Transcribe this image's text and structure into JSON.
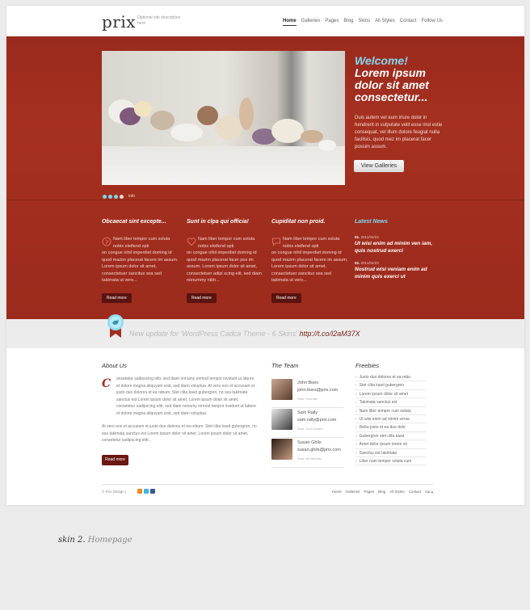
{
  "header": {
    "logo": "prix",
    "tagline": "Optional site description here",
    "nav": [
      "Home",
      "Galleries",
      "Pages",
      "Blog",
      "Skins",
      "All Styles",
      "Contact",
      "Follow Us"
    ],
    "active_nav": "Home"
  },
  "hero": {
    "welcome": "Welcome!",
    "headline": "Lorem ipsum dolor sit amet consectetur...",
    "text": "Duis autem vel eum iriure dolor in hendrerit in vulputate velit esse mol estie consequat, vel illum dolore feugiat nulla facilisis, quod mez im placerat facer possim assum.",
    "button": "View Galleries",
    "slider_info": "info"
  },
  "columns": [
    {
      "title": "Obcaecat sint excepte...",
      "icon": "circle-arrow-icon",
      "text_first": "Nam liber tempor cum soluta nobis eleifend opti",
      "text_rest": "on congue nihil imperdiet doming id quod mazim placerat facere im assum. Lorem ipsum dolor sit amet, consectetuer sancitus sea sed takimata ut vero...",
      "button": "Read more"
    },
    {
      "title": "Sunt in clpa qui officia!",
      "icon": "heart-icon",
      "text_first": "Nam liber tempor cum soluta nobis eleifend opti",
      "text_rest": "on congue nihil imperdiet doming id quod mazim placerat facer pos im assum. Lorem ipsum dolor sit amet, consectetuer adipi scing elit, sed diam nonummy nibh...",
      "button": "Read more"
    },
    {
      "title": "Cupiditat non proid.",
      "icon": "speech-bubble-icon",
      "text_first": "Nam liber tempor cum soluta nobis eleifend opti",
      "text_rest": "on congue nihil imperdiet doming id quod mazim placerat facere im assum. Lorem ipsum dolor sit amet, consectetuer sancitus sea sed takimata ut vero...",
      "button": "Read more"
    }
  ],
  "news": {
    "title": "Latest News",
    "items": [
      {
        "num": "01.",
        "date": "2011/04/24",
        "title": "Ut wisi enim ad minim ven iam, quis nostrud exerci"
      },
      {
        "num": "02.",
        "date": "2011/04/23",
        "title": "Nostrud wisi veniam enim ad minim quis exerci ut"
      }
    ]
  },
  "twitter": {
    "text": "New update for 'WordPress Cadca Theme - 6 Skins'",
    "link": "http://t.co/l2aM37X"
  },
  "about": {
    "title": "About Us",
    "para1": "onsetetur sadipscing elitr, sed diam nonumy eirmod tempor invidunt ut labore et dolore magna aliquyam erat, sed diam voluptua. At vero eos et accusam et justo duo dolores et ea rebum. Stet clita kasd gubergren, no sea takimata sanctus est Lorem ipsum dolor sit amet. Lorem ipsum dolor sit amet, consetetur sadipscing elitr, sed diam nonumy eirmod tempor invidunt ut labore et dolore magna aliquyam erat, sed diam voluptua.",
    "para2": "At vero eos et accusam et justo duo dolores et ea rebum. Stet clita kasd gubergren, no sea takimata sanctus est Lorem ipsum dolor sit amet. Lorem ipsum dolor sit amet, consetetur sadipscing elitr...",
    "button": "Read more"
  },
  "team": {
    "title": "The Team",
    "members": [
      {
        "name": "John Boes",
        "email": "john.boes@prix.com",
        "role": "Role: Founder"
      },
      {
        "name": "Sam Rally",
        "email": "sam.rally@prix.com",
        "role": "Role: Co-Founder"
      },
      {
        "name": "Susan Ghils",
        "email": "susan.ghils@prix.com",
        "role": "Role: Art Director"
      }
    ]
  },
  "freebies": {
    "title": "Freebies",
    "items": [
      "Justo duo dolores et ea rebu",
      "Stet clita kasd gubergren",
      "Lorem ipsum dolor sit amet",
      "Takimata sanctus est",
      "Nam liber tempor cum soluta",
      "Ut wisi enim ad minim venia",
      "Rebu justo et ea duo dolo",
      "Gubergren stet clita kasd",
      "Amet dolor ipsum lorem sit",
      "Sanctus est takimata",
      "Liber nam tempor soluta cum"
    ]
  },
  "footer": {
    "copyright": "© Prix Design |",
    "nav": [
      "Home",
      "Galleries",
      "Pages",
      "Blog",
      "All Styles",
      "Contact",
      "top"
    ]
  },
  "caption": {
    "main": "skin 2.",
    "sub": "Homepage"
  },
  "colors": {
    "brand_red": "#a0301f",
    "accent_blue": "#7fd9f0"
  }
}
